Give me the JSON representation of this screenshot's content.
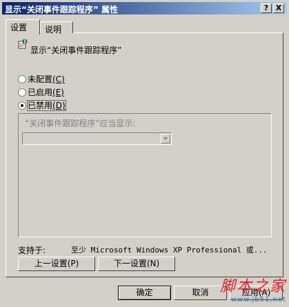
{
  "window": {
    "title": "显示“关闭事件跟踪程序” 属性",
    "help_label": "?",
    "close_label": "X"
  },
  "tabs": [
    {
      "label": "设置"
    },
    {
      "label": "说明"
    }
  ],
  "policy": {
    "name": "显示“关闭事件跟踪程序”",
    "icon": "policy-setting-icon"
  },
  "options": [
    {
      "label": "未配置",
      "hotkey": "(C)",
      "checked": false
    },
    {
      "label": "已启用",
      "hotkey": "(E)",
      "checked": false
    },
    {
      "label": "已禁用",
      "hotkey": "(D)",
      "checked": true
    }
  ],
  "options_group": {
    "prompt": "“关闭事件跟踪程序”应当显示:",
    "select_value": ""
  },
  "support": {
    "label": "支持于:",
    "value": "至少 Microsoft Windows XP Professional 或..."
  },
  "nav_buttons": {
    "prev": "上一设置(P)",
    "next": "下一设置(N)"
  },
  "footer_buttons": {
    "ok": "确定",
    "cancel": "取消",
    "apply": "应用(A)"
  },
  "watermark": {
    "main": "脚本之家",
    "sub": "www.jb51.net"
  },
  "colors": {
    "title_gradient_start": "#0a246a",
    "title_gradient_end": "#a6caf0",
    "face": "#d4d0c8",
    "watermark_red": "#e0202a",
    "watermark_blue": "#2a6fc8"
  }
}
